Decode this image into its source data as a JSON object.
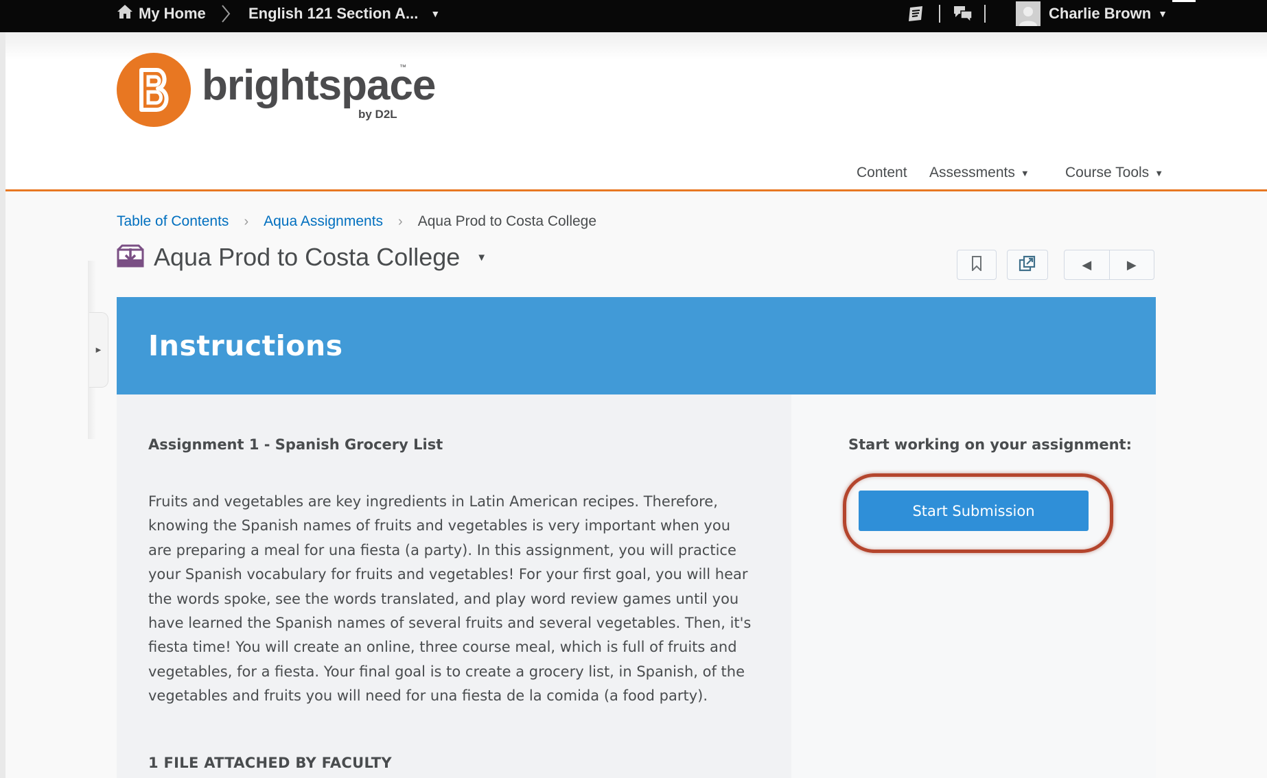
{
  "minibar": {
    "home_label": "My Home",
    "course_label": "English 121 Section A...",
    "user_name": "Charlie Brown",
    "icons": [
      "home-icon",
      "chevron-right-icon",
      "caret-down-icon",
      "update-alerts-icon",
      "messages-icon",
      "avatar-icon"
    ]
  },
  "header": {
    "logo_word": "brightspace",
    "logo_tm": "™",
    "logo_by": "by D2L",
    "nav": {
      "content": "Content",
      "assessments": "Assessments",
      "course_tools": "Course Tools"
    }
  },
  "breadcrumb": {
    "items": [
      "Table of Contents",
      "Aqua Assignments"
    ],
    "current": "Aqua Prod to Costa College"
  },
  "page": {
    "title": "Aqua Prod to Costa College"
  },
  "instructions": {
    "heading": "Instructions",
    "assignment_title": "Assignment 1 - Spanish Grocery List",
    "body": "Fruits and vegetables are key ingredients in Latin American recipes. Therefore, knowing the Spanish names of fruits and vegetables is very important when you are preparing a meal for una fiesta (a party). In this assignment, you will practice your Spanish vocabulary for fruits and vegetables! For your first goal, you will hear the words spoke, see the words translated, and play word review games until you have learned the Spanish names of several fruits and several vegetables. Then, it's fiesta time! You will create an online, three course meal, which is full of fruits and vegetables, for a fiesta. Your final goal is to create a grocery list, in Spanish, of the vegetables and fruits you will need for una fiesta de la comida (a food party).",
    "attached_label": "1 FILE ATTACHED BY FACULTY"
  },
  "submission": {
    "prompt": "Start working on your assignment:",
    "button_label": "Start Submission"
  },
  "colors": {
    "brand_orange": "#e87722",
    "banner_blue": "#419ad7",
    "button_blue": "#2f8fd8",
    "link_blue": "#006fbf",
    "highlight_red": "#b4452d"
  }
}
